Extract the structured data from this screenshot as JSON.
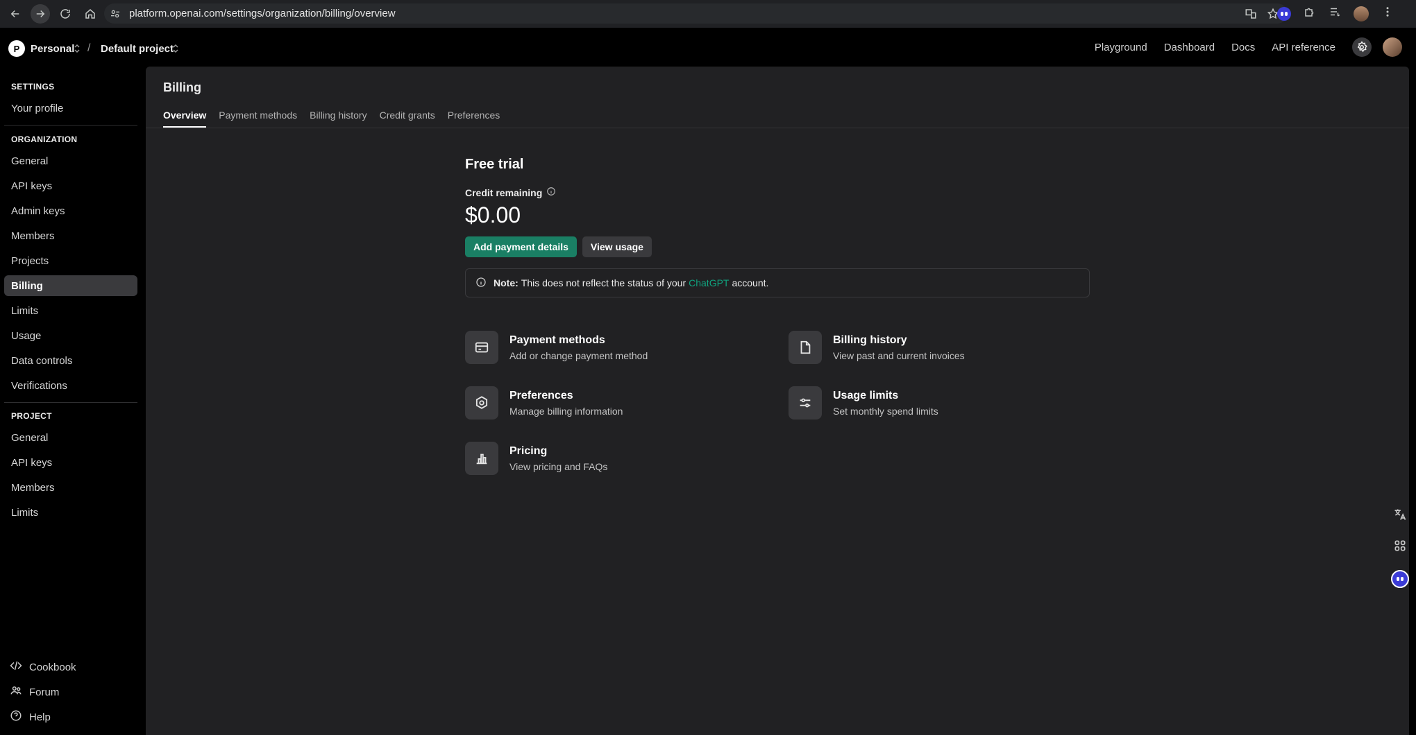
{
  "browser": {
    "url": "platform.openai.com/settings/organization/billing/overview"
  },
  "topbar": {
    "org_initial": "P",
    "org_name": "Personal",
    "separator": "/",
    "project_name": "Default project",
    "links": [
      "Playground",
      "Dashboard",
      "Docs",
      "API reference"
    ]
  },
  "sidebar": {
    "settings_heading": "SETTINGS",
    "settings_items": [
      "Your profile"
    ],
    "organization_heading": "ORGANIZATION",
    "organization_items": [
      "General",
      "API keys",
      "Admin keys",
      "Members",
      "Projects",
      "Billing",
      "Limits",
      "Usage",
      "Data controls",
      "Verifications"
    ],
    "active_item": "Billing",
    "project_heading": "PROJECT",
    "project_items": [
      "General",
      "API keys",
      "Members",
      "Limits"
    ],
    "footer_items": [
      "Cookbook",
      "Forum",
      "Help"
    ]
  },
  "main": {
    "title": "Billing",
    "tabs": [
      "Overview",
      "Payment methods",
      "Billing history",
      "Credit grants",
      "Preferences"
    ],
    "active_tab": "Overview",
    "plan": "Free trial",
    "credit_label": "Credit remaining",
    "credit_value": "$0.00",
    "primary_button": "Add payment details",
    "secondary_button": "View usage",
    "note": {
      "bold": "Note:",
      "text_before": "This does not reflect the status of your",
      "link": "ChatGPT",
      "text_after": "account."
    },
    "cards": [
      {
        "title": "Payment methods",
        "subtitle": "Add or change payment method",
        "icon": "credit-card-icon"
      },
      {
        "title": "Billing history",
        "subtitle": "View past and current invoices",
        "icon": "document-icon"
      },
      {
        "title": "Preferences",
        "subtitle": "Manage billing information",
        "icon": "gear-icon"
      },
      {
        "title": "Usage limits",
        "subtitle": "Set monthly spend limits",
        "icon": "sliders-icon"
      },
      {
        "title": "Pricing",
        "subtitle": "View pricing and FAQs",
        "icon": "bar-chart-icon"
      }
    ]
  },
  "colors": {
    "accent_green": "#1a7f64",
    "link_green": "#10a37f",
    "panel_bg": "#212123",
    "sidebar_bg": "#000000"
  }
}
